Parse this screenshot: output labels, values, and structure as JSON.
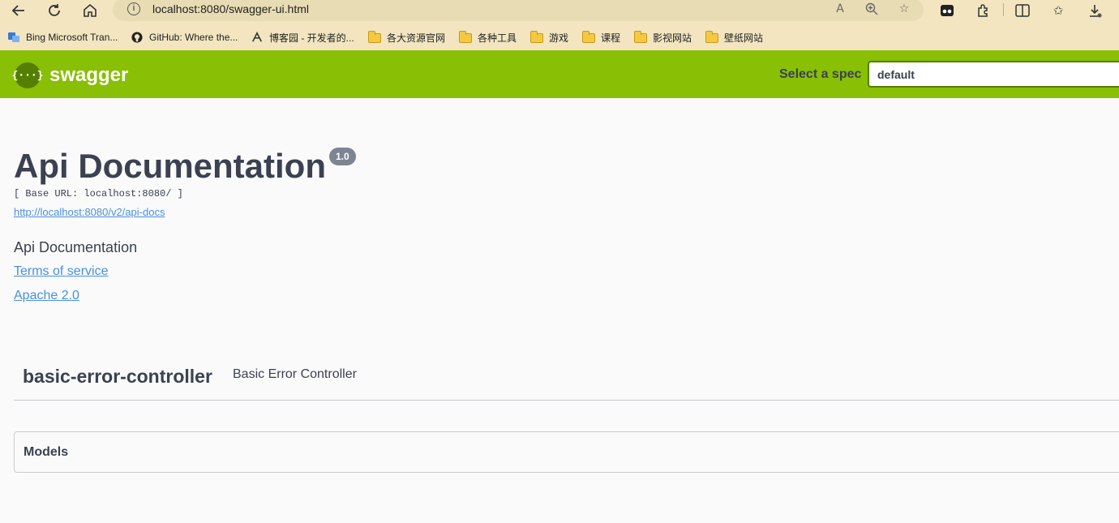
{
  "browser": {
    "url": "localhost:8080/swagger-ui.html",
    "bookmarks": [
      {
        "label": "Bing Microsoft Tran...",
        "icon": "bing-translator-icon"
      },
      {
        "label": "GitHub: Where the...",
        "icon": "github-icon"
      },
      {
        "label": "博客园 - 开发者的...",
        "icon": "cnblogs-icon"
      },
      {
        "label": "各大资源官网",
        "icon": "folder-icon"
      },
      {
        "label": "各种工具",
        "icon": "folder-icon"
      },
      {
        "label": "游戏",
        "icon": "folder-icon"
      },
      {
        "label": "课程",
        "icon": "folder-icon"
      },
      {
        "label": "影视网站",
        "icon": "folder-icon"
      },
      {
        "label": "壁纸网站",
        "icon": "folder-icon"
      }
    ]
  },
  "header": {
    "logo_text": "swagger",
    "logo_glyph": "{···}",
    "spec_label": "Select a spec",
    "spec_value": "default",
    "accent": "#89bf04"
  },
  "info": {
    "title": "Api Documentation",
    "version": "1.0",
    "base_url": "[ Base URL: localhost:8080/ ]",
    "api_docs_link": "http://localhost:8080/v2/api-docs",
    "description": "Api Documentation",
    "terms": "Terms of service",
    "license": "Apache 2.0"
  },
  "controllers": [
    {
      "name": "basic-error-controller",
      "description": "Basic Error Controller"
    }
  ],
  "models": {
    "label": "Models"
  }
}
